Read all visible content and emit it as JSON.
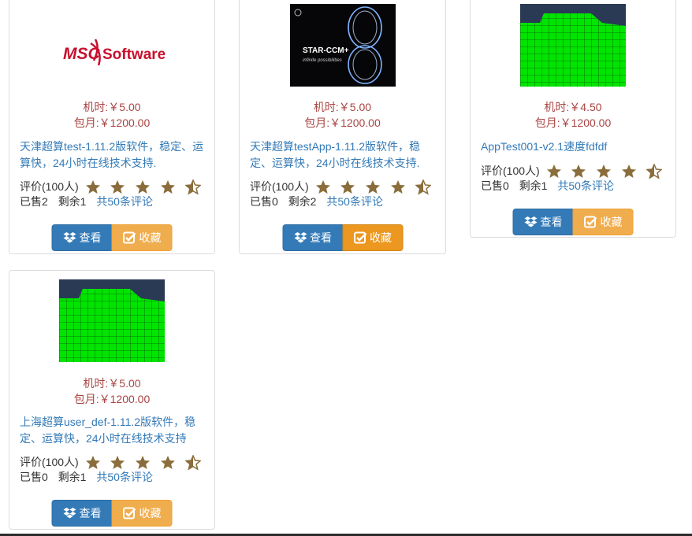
{
  "labels": {
    "view": "查看",
    "fav": "收藏"
  },
  "products": [
    {
      "image": "msc-software-logo",
      "hourly": "机时:￥5.00",
      "monthly": "包月:￥1200.00",
      "title": "天津超算test-1.11.2版软件，稳定、运算快，24小时在线技术支持.",
      "rating_label": "评价(100人)",
      "rating": 4.5,
      "sold": "已售2",
      "remaining": "剩余1",
      "reviews": "共50条评论"
    },
    {
      "image": "star-ccm-logo",
      "hourly": "机时:￥5.00",
      "monthly": "包月:￥1200.00",
      "title": "天津超算testApp-1.11.2版软件，稳定、运算快，24小时在线技术支持.",
      "rating_label": "评价(100人)",
      "rating": 4.5,
      "sold": "已售0",
      "remaining": "剩余2",
      "reviews": "共50条评论"
    },
    {
      "image": "green-mesh-image",
      "hourly": "机时:￥4.50",
      "monthly": "包月:￥1200.00",
      "title": "AppTest001-v2.1速度fdfdf",
      "rating_label": "评价(100人)",
      "rating": 4.5,
      "sold": "已售0",
      "remaining": "剩余1",
      "reviews": "共50条评论"
    },
    {
      "image": "green-mesh-image",
      "hourly": "机时:￥5.00",
      "monthly": "包月:￥1200.00",
      "title": "上海超算user_def-1.11.2版软件，稳定、运算快，24小时在线技术支持",
      "rating_label": "评价(100人)",
      "rating": 4.5,
      "sold": "已售0",
      "remaining": "剩余1",
      "reviews": "共50条评论"
    }
  ]
}
